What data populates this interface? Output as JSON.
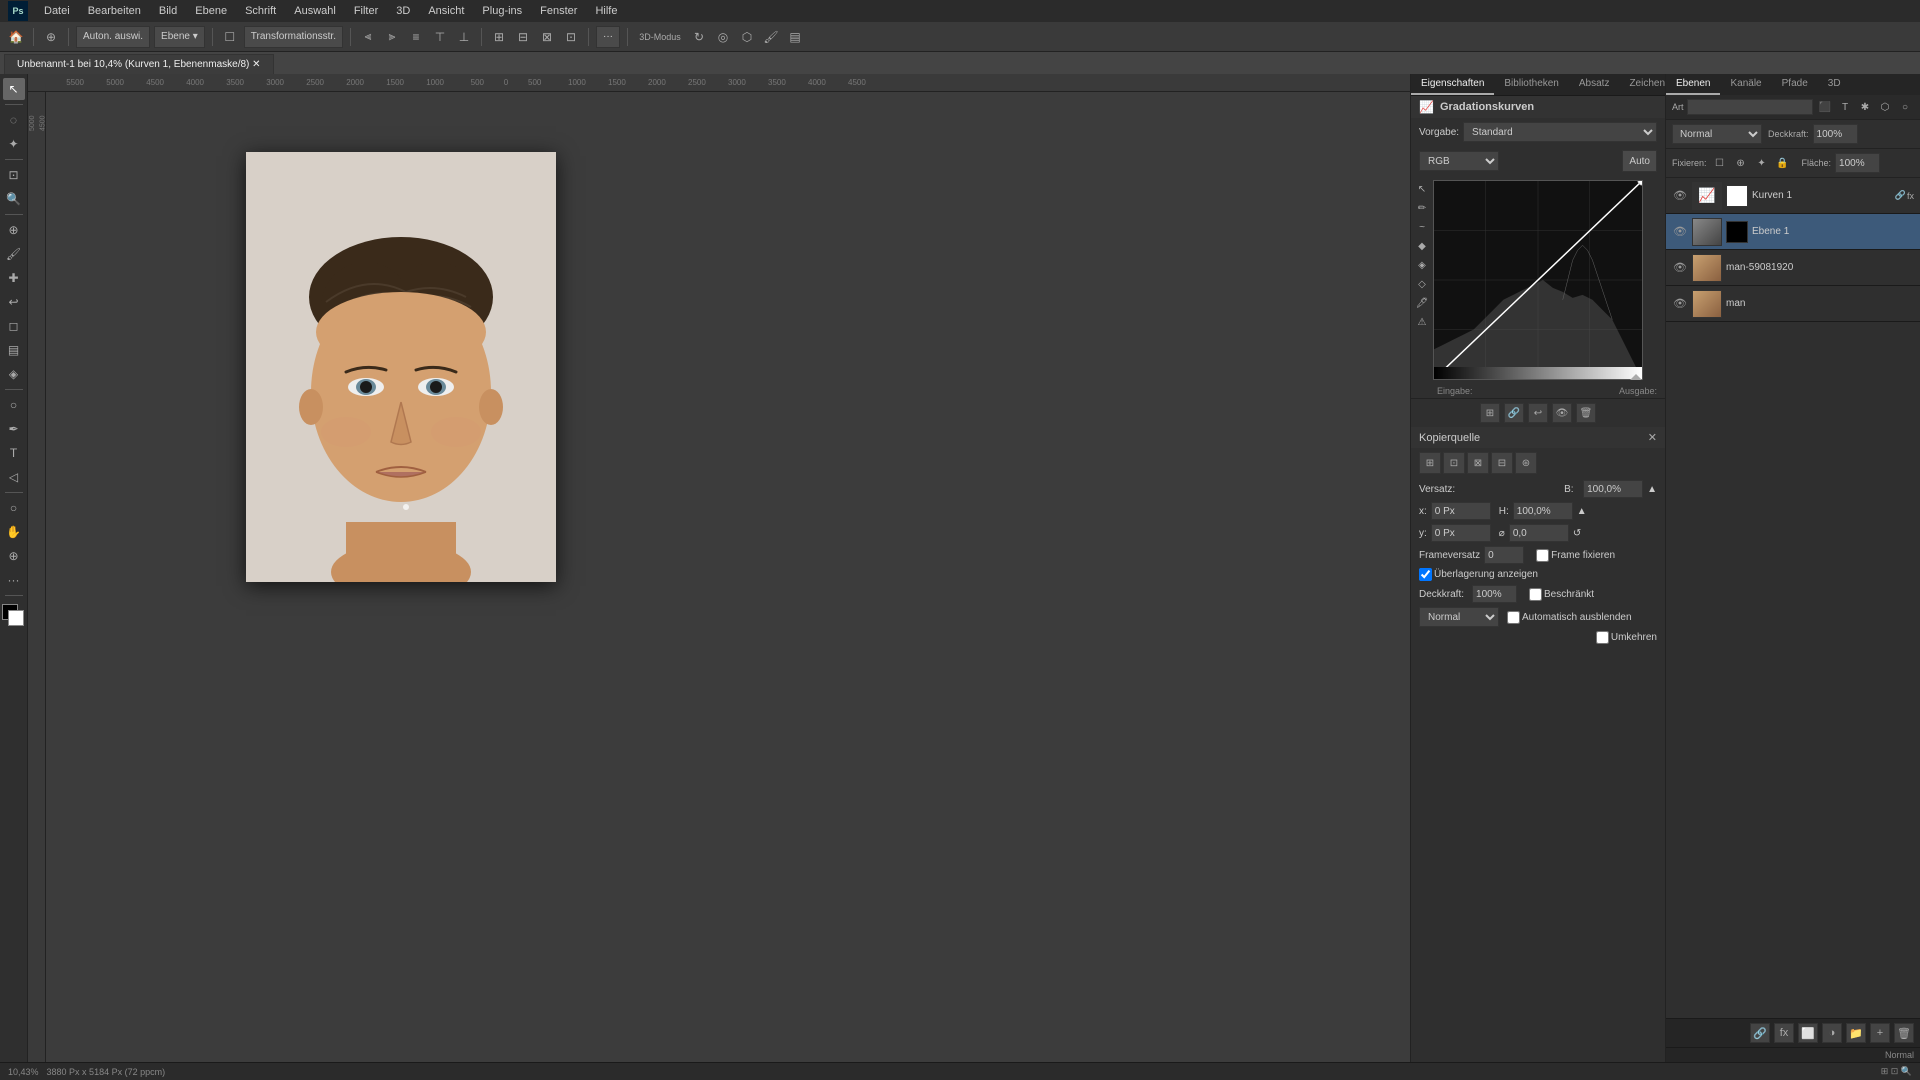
{
  "app": {
    "title": "Adobe Photoshop",
    "brand": "Ps"
  },
  "menubar": {
    "items": [
      "Datei",
      "Bearbeiten",
      "Bild",
      "Ebene",
      "Schrift",
      "Auswahl",
      "Filter",
      "3D",
      "Ansicht",
      "Plug-ins",
      "Fenster",
      "Hilfe"
    ]
  },
  "toolbar": {
    "home_label": "🏠",
    "auto_label": "Auton. auswi.",
    "ebene_label": "Ebene ▾",
    "transform_label": "Transformationsstr.",
    "more_btn": "···"
  },
  "tab": {
    "label": "Unbenannt-1 bei 10,4% (Kurven 1, Ebenenmaske/8) ✕",
    "close": "×"
  },
  "properties": {
    "title": "Gradationskurven",
    "panel_tabs": [
      "Eigenschaften",
      "Bibliotheken",
      "Absatz",
      "Zeichen"
    ],
    "vorgabe_label": "Vorgabe:",
    "vorgabe_value": "Standard",
    "channel_label": "RGB",
    "auto_label": "Auto",
    "eingabe_label": "Eingabe:",
    "ausgabe_label": "Ausgabe:"
  },
  "kopierquelle": {
    "title": "Kopierquelle"
  },
  "kopierquelle_fields": {
    "versatz_label": "Versatz:",
    "b_label": "B:",
    "b_value": "100,0%",
    "x_label": "x:",
    "x_value": "0 Px",
    "h_label": "H:",
    "h_value": "100,0%",
    "y_label": "y:",
    "y_value": "0 Px",
    "angle_value": "0,0",
    "frameversatz_label": "Frameversatz",
    "frameversatz_value": "0",
    "frame_fix_label": "Frame fixieren",
    "uberlagerung_label": "Überlagerung anzeigen",
    "deckkraft_label": "Deckkraft:",
    "deckkraft_value": "100%",
    "beschrankt_label": "Beschränkt",
    "auto_label": "Automatisch ausblenden",
    "normal_label": "Normal",
    "umkehren_label": "Umkehren"
  },
  "layers": {
    "tabs": [
      "Ebenen",
      "Kanäle",
      "Pfade",
      "3D"
    ],
    "mode_label": "Normal",
    "deckkraft_label": "Deckkraft:",
    "deckkraft_value": "100%",
    "flache_label": "Fläche:",
    "flache_value": "100%",
    "items": [
      {
        "name": "Kurven 1",
        "type": "adjustment",
        "visible": true,
        "active": false,
        "has_mask": true
      },
      {
        "name": "Ebene 1",
        "type": "layer",
        "visible": true,
        "active": true,
        "has_mask": false
      },
      {
        "name": "man-59081920",
        "type": "image",
        "visible": true,
        "active": false,
        "has_mask": false
      },
      {
        "name": "man",
        "type": "image",
        "visible": true,
        "active": false,
        "has_mask": false
      }
    ]
  },
  "statusbar": {
    "zoom": "10,43%",
    "dimensions": "3880 Px x 5184 Px (72 ppcm)",
    "mode_label": "Normal"
  }
}
